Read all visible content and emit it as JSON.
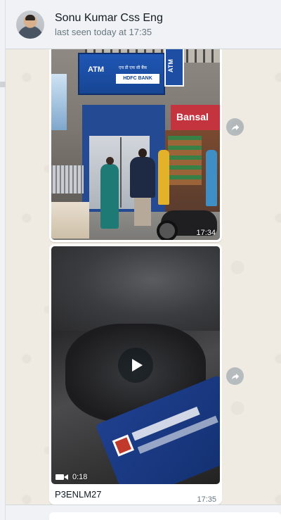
{
  "header": {
    "contact_name": "Sonu Kumar Css Eng",
    "status": "last seen today at 17:35"
  },
  "messages": [
    {
      "type": "image",
      "description_icon": "photo",
      "time": "17:34",
      "photo_signs": {
        "atm": "ATM",
        "bank": "HDFC BANK",
        "bank_hindi": "एच डी एफ सी बैंक",
        "atm_vertical": "ATM",
        "shop": "Bansal"
      }
    },
    {
      "type": "video",
      "duration": "0:18",
      "caption": "P3ENLM27",
      "time": "17:35"
    }
  ],
  "icons": {
    "forward": "forward-arrow-icon",
    "play": "play-icon",
    "video_camera": "video-camera-icon"
  },
  "colors": {
    "header_bg": "#f0f2f5",
    "chat_bg": "#efeae2",
    "bubble_bg": "#ffffff",
    "primary_text": "#111b21",
    "secondary_text": "#667781"
  }
}
